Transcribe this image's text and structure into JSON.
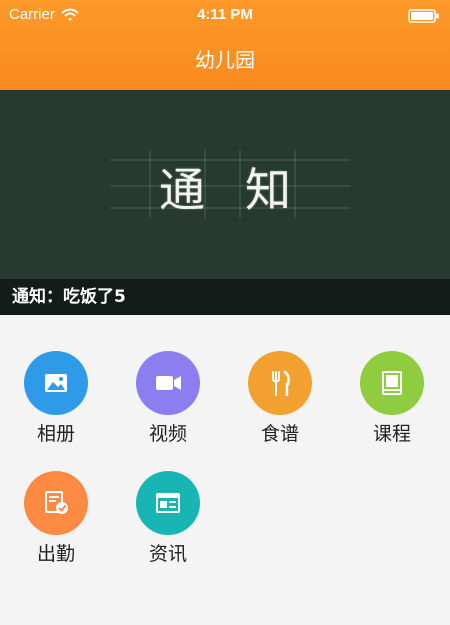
{
  "status_bar": {
    "carrier": "Carrier",
    "time": "4:11 PM"
  },
  "header": {
    "title": "幼儿园"
  },
  "banner": {
    "big_text": "通知",
    "caption": "通知：吃饭了5"
  },
  "menu": {
    "items": [
      {
        "label": "相册",
        "icon": "photo-album-icon",
        "color": "#2f9ae8"
      },
      {
        "label": "视频",
        "icon": "video-camera-icon",
        "color": "#8c7df0"
      },
      {
        "label": "食谱",
        "icon": "fork-knife-icon",
        "color": "#f2a130"
      },
      {
        "label": "课程",
        "icon": "book-icon",
        "color": "#8fcc3f"
      },
      {
        "label": "出勤",
        "icon": "attendance-icon",
        "color": "#fd8a43"
      },
      {
        "label": "资讯",
        "icon": "news-icon",
        "color": "#18b6b2"
      }
    ]
  }
}
